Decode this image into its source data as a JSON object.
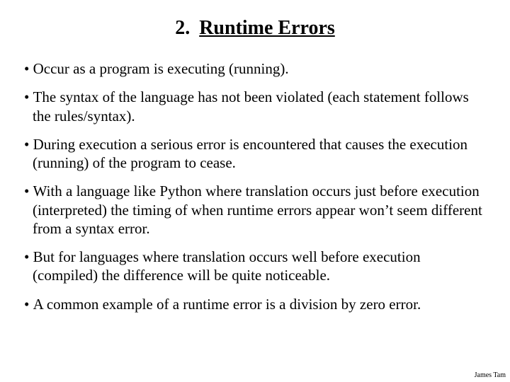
{
  "title": {
    "number": "2.",
    "text": "Runtime Errors"
  },
  "bullets": [
    "Occur as a program is executing (running).",
    "The syntax of the language has not been violated (each statement follows the rules/syntax).",
    "During execution a serious error is encountered that causes the execution (running) of the program to cease.",
    "With a language like Python where translation occurs just before execution (interpreted) the timing of when runtime errors appear won’t seem different from a syntax error.",
    "But for languages where translation occurs well before execution (compiled) the difference will be quite noticeable.",
    "A common example of a runtime error is a division by zero error."
  ],
  "footer": "James Tam"
}
